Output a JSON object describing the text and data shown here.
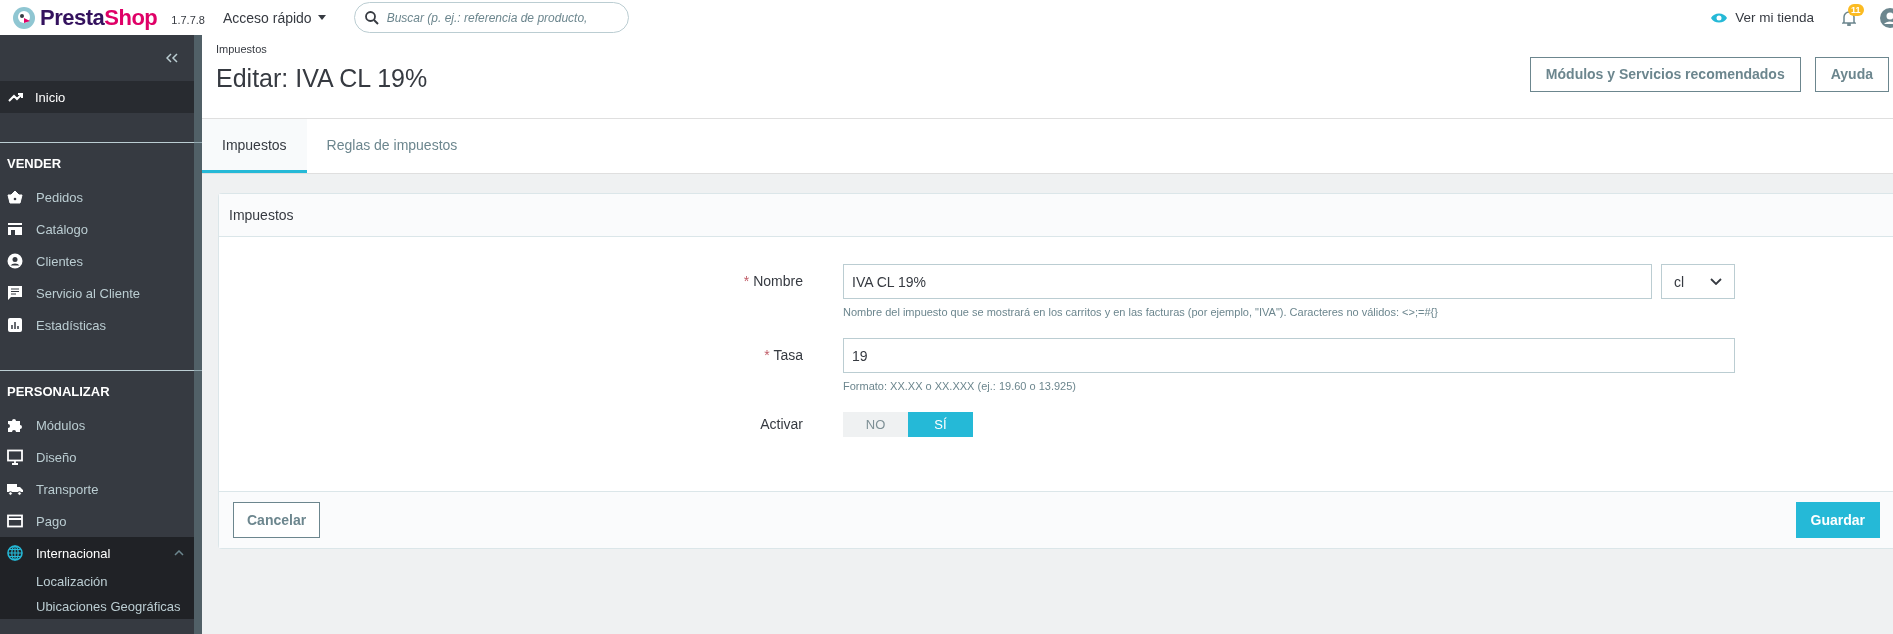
{
  "topbar": {
    "logo": [
      "Presta",
      "Shop"
    ],
    "version": "1.7.7.8",
    "quick_access": "Acceso rápido",
    "search": {
      "placeholder": "Buscar (p. ej.: referencia de producto,"
    },
    "view_store": "Ver mi tienda",
    "notifications": "11"
  },
  "sidebar": {
    "home": {
      "label": "Inicio"
    },
    "sections": [
      {
        "title": "VENDER",
        "items": [
          {
            "label": "Pedidos",
            "selected": false
          },
          {
            "label": "Catálogo",
            "selected": false
          },
          {
            "label": "Clientes",
            "selected": false
          },
          {
            "label": "Servicio al Cliente",
            "selected": false
          },
          {
            "label": "Estadísticas",
            "selected": false
          }
        ]
      },
      {
        "title": "PERSONALIZAR",
        "items": [
          {
            "label": "Módulos",
            "selected": false
          },
          {
            "label": "Diseño",
            "selected": false
          },
          {
            "label": "Transporte",
            "selected": false
          },
          {
            "label": "Pago",
            "selected": false
          },
          {
            "label": "Internacional",
            "selected": true,
            "children": [
              {
                "label": "Localización"
              },
              {
                "label": "Ubicaciones Geográficas"
              }
            ]
          }
        ]
      }
    ]
  },
  "header": {
    "breadcrumb": "Impuestos",
    "title": "Editar: IVA CL 19%",
    "buttons": [
      "Módulos y Servicios recomendados",
      "Ayuda"
    ]
  },
  "tabs": [
    {
      "label": "Impuestos",
      "selected": true
    },
    {
      "label": "Reglas de impuestos",
      "selected": false
    }
  ],
  "panel": {
    "title": "Impuestos",
    "fields": [
      {
        "kind": "text",
        "label": "Nombre",
        "marker": "*",
        "value": "IVA CL 19%",
        "language": "cl",
        "help": "Nombre del impuesto que se mostrará en los carritos y en las facturas (por ejemplo, \"IVA\"). Caracteres no válidos: <>;=#{}"
      },
      {
        "kind": "text",
        "label": "Tasa",
        "marker": "*",
        "value": "19",
        "help": "Formato: XX.XX o XX.XXX (ej.: 19.60 o 13.925)"
      },
      {
        "kind": "switch",
        "label": "Activar",
        "options": [
          {
            "label": "NO",
            "selected": false
          },
          {
            "label": "SÍ",
            "selected": true
          }
        ]
      }
    ],
    "cancel": "Cancelar",
    "save": "Guardar"
  }
}
